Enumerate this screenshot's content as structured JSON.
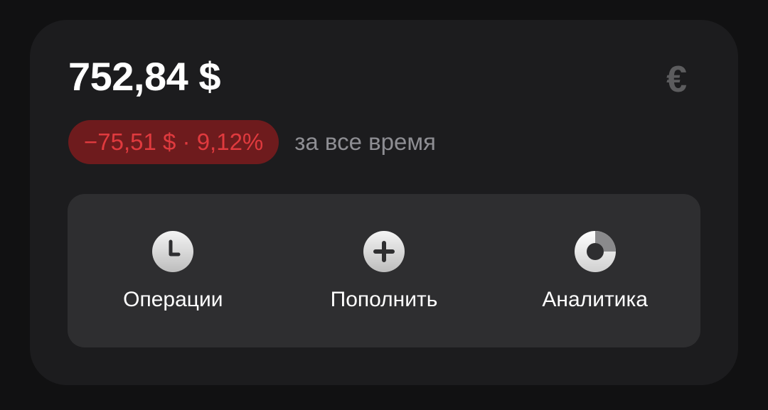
{
  "balance": {
    "amount": "752,84 $",
    "currency_toggle": "€",
    "change": "−75,51 $ · 9,12%",
    "period": "за все время"
  },
  "colors": {
    "background": "#111112",
    "card": "#1c1c1e",
    "actions_panel": "#2e2e30",
    "negative_text": "#e03a3e",
    "negative_badge": "#6e1b1d",
    "muted_text": "#8e8e93"
  },
  "actions": [
    {
      "label": "Операции",
      "icon": "clock-icon"
    },
    {
      "label": "Пополнить",
      "icon": "plus-icon"
    },
    {
      "label": "Аналитика",
      "icon": "donut-chart-icon"
    }
  ]
}
